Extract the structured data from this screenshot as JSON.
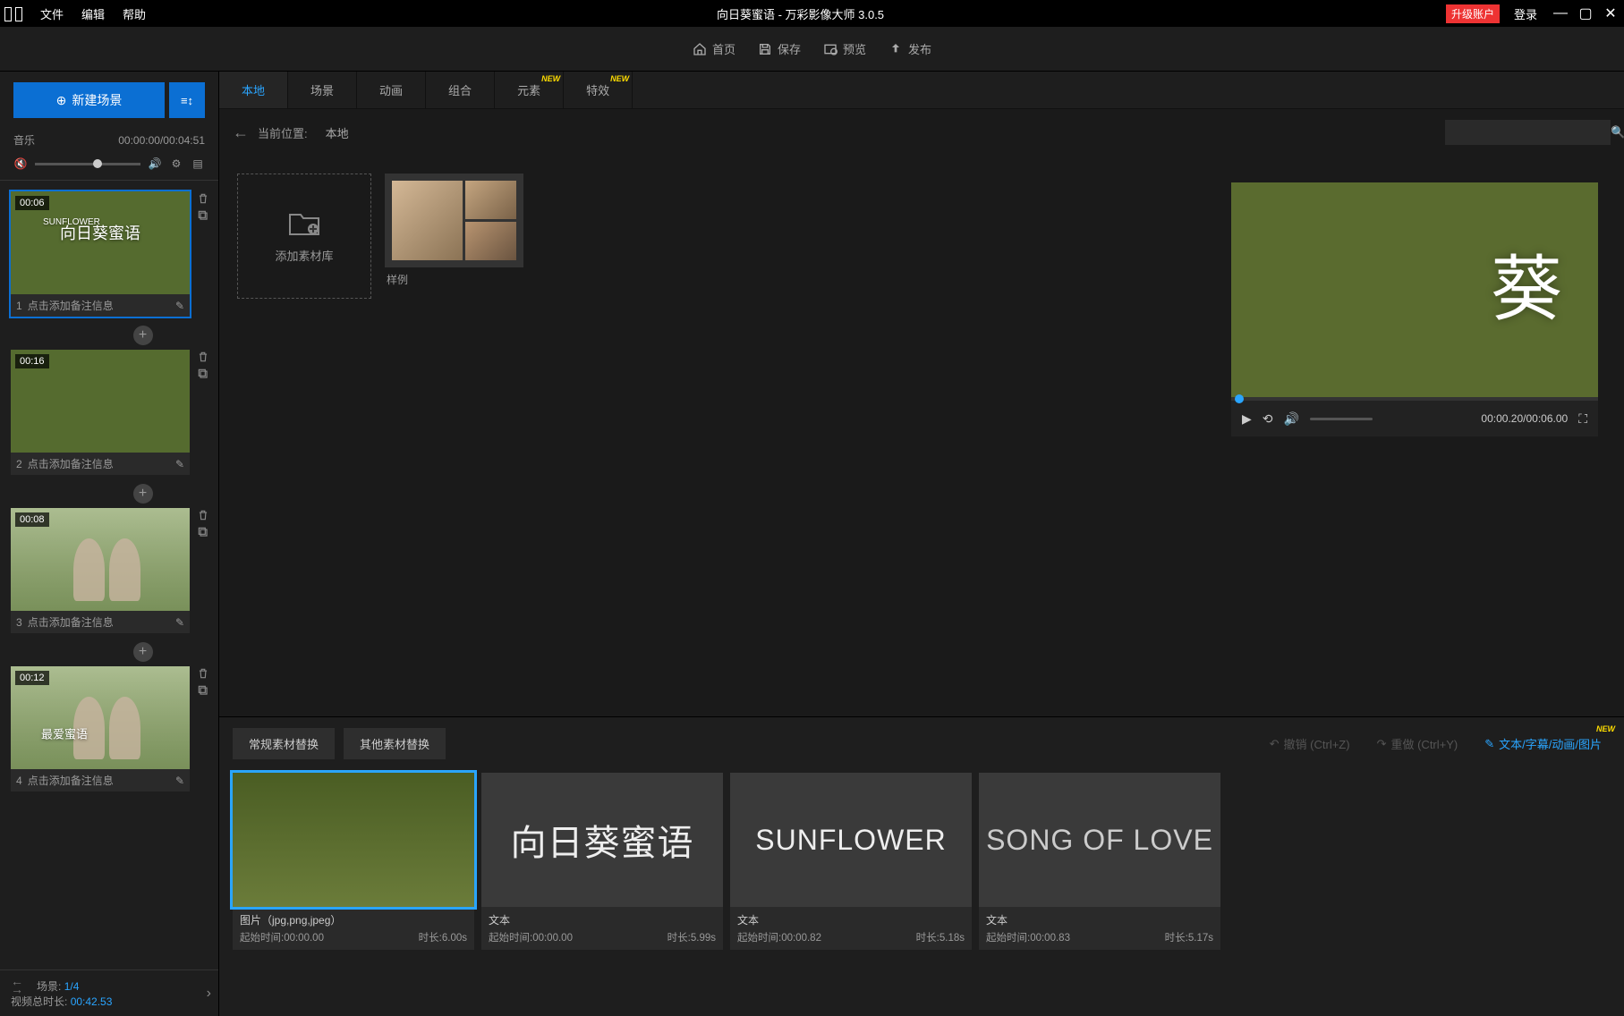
{
  "titlebar": {
    "menu": {
      "file": "文件",
      "edit": "编辑",
      "help": "帮助"
    },
    "title": "向日葵蜜语 - 万彩影像大师 3.0.5",
    "upgrade": "升级账户",
    "login": "登录"
  },
  "toolbar": {
    "home": "首页",
    "save": "保存",
    "preview": "预览",
    "publish": "发布"
  },
  "sidebar": {
    "new_scene": "新建场景",
    "music_label": "音乐",
    "music_time": "00:00:00/00:04:51",
    "scenes": [
      {
        "dur": "00:06",
        "note": "点击添加备注信息",
        "title": "向日葵蜜语",
        "sub": "SUNFLOWER"
      },
      {
        "dur": "00:16",
        "note": "点击添加备注信息"
      },
      {
        "dur": "00:08",
        "note": "点击添加备注信息"
      },
      {
        "dur": "00:12",
        "note": "点击添加备注信息",
        "overlay": "最爱蜜语"
      }
    ],
    "footer": {
      "scene_label": "场景:",
      "scene_val": "1/4",
      "total_label": "视频总时长:",
      "total_val": "00:42.53"
    }
  },
  "asset_tabs": [
    "本地",
    "场景",
    "动画",
    "组合",
    "元素",
    "特效"
  ],
  "breadcrumb": {
    "label": "当前位置:",
    "value": "本地"
  },
  "library": {
    "add_folder": "添加素材库",
    "sample_folder": "样例"
  },
  "preview": {
    "char": "葵",
    "time": "00:00.20/00:06.00"
  },
  "timeline": {
    "tab_regular": "常规素材替换",
    "tab_other": "其他素材替换",
    "undo": "撤销 (Ctrl+Z)",
    "redo": "重做 (Ctrl+Y)",
    "text_edit": "文本/字幕/动画/图片",
    "clips": [
      {
        "type": "img",
        "title": "图片（jpg,png,jpeg）",
        "start": "起始时间:00:00.00",
        "dur": "时长:6.00s"
      },
      {
        "type": "text",
        "content": "向日葵蜜语",
        "title": "文本",
        "start": "起始时间:00:00.00",
        "dur": "时长:5.99s"
      },
      {
        "type": "text",
        "content": "SUNFLOWER",
        "title": "文本",
        "start": "起始时间:00:00.82",
        "dur": "时长:5.18s"
      },
      {
        "type": "text",
        "content": "SONG OF LOVE",
        "title": "文本",
        "start": "起始时间:00:00.83",
        "dur": "时长:5.17s"
      }
    ]
  }
}
